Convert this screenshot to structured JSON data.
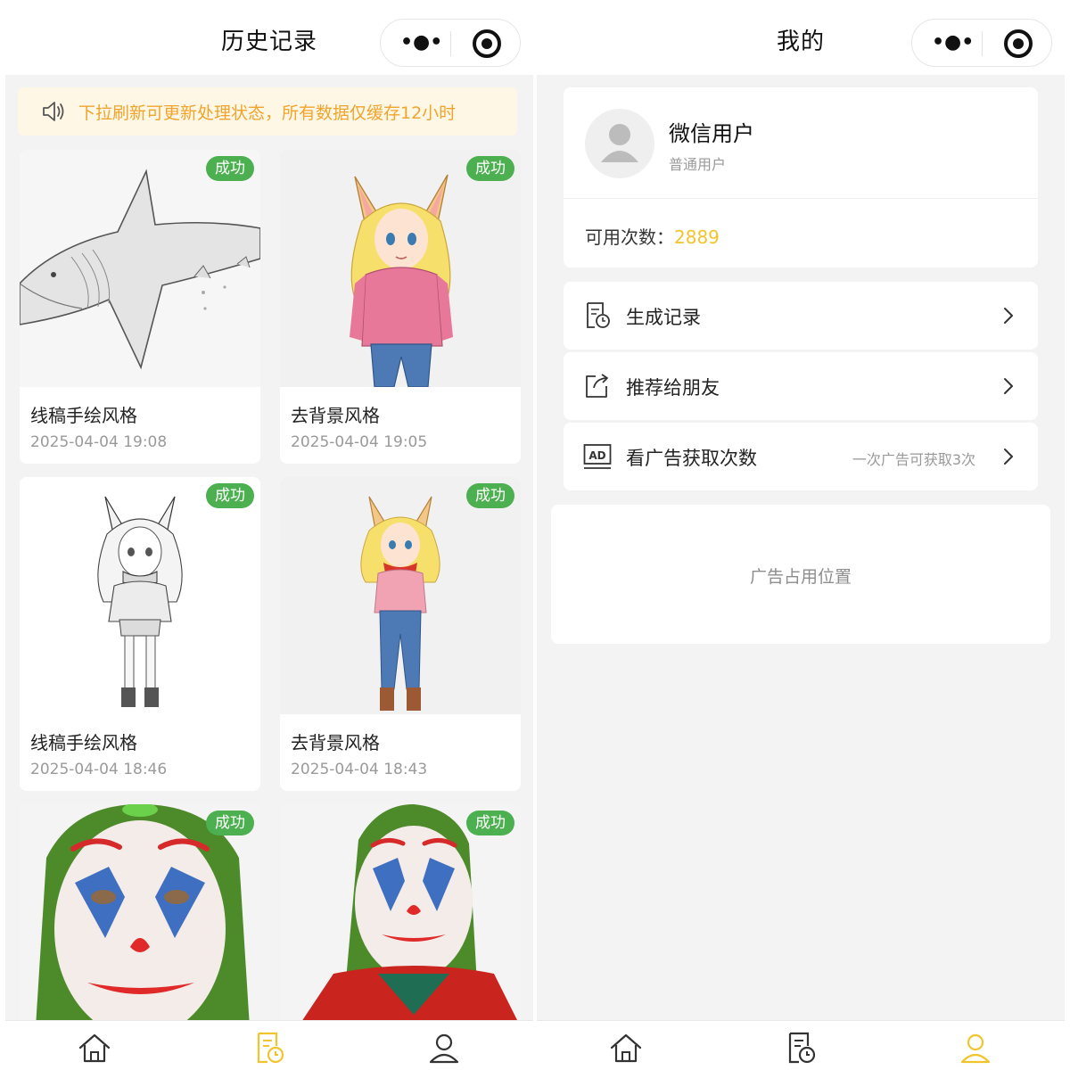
{
  "history": {
    "title": "历史记录",
    "notice": "下拉刷新可更新处理状态，所有数据仅缓存12小时",
    "items": [
      {
        "status": "成功",
        "style": "线稿手绘风格",
        "time": "2025-04-04 19:08"
      },
      {
        "status": "成功",
        "style": "去背景风格",
        "time": "2025-04-04 19:05"
      },
      {
        "status": "成功",
        "style": "线稿手绘风格",
        "time": "2025-04-04 18:46"
      },
      {
        "status": "成功",
        "style": "去背景风格",
        "time": "2025-04-04 18:43"
      },
      {
        "status": "成功"
      },
      {
        "status": "成功"
      }
    ]
  },
  "profile": {
    "title": "我的",
    "user_name": "微信用户",
    "user_type": "普通用户",
    "credits_label": "可用次数：",
    "credits_value": "2889",
    "menu": [
      {
        "label": "生成记录",
        "hint": ""
      },
      {
        "label": "推荐给朋友",
        "hint": ""
      },
      {
        "label": "看广告获取次数",
        "hint": "一次广告可获取3次"
      }
    ],
    "ad_placeholder": "广告占用位置"
  },
  "capsule": {
    "more_glyph": "•●•"
  },
  "colors": {
    "success_badge": "#4caf50",
    "notice_bg": "#fff7e6",
    "notice_text": "#f0a42c",
    "active_tab": "#f2c42c",
    "credits_value": "#f2c42c"
  },
  "icons": {
    "notice": "speaker-icon",
    "tabs": [
      "home-icon",
      "history-icon",
      "user-icon"
    ],
    "menu": [
      "record-icon",
      "share-icon",
      "ad-icon"
    ],
    "capsule": [
      "more-icon",
      "close-target-icon"
    ]
  }
}
